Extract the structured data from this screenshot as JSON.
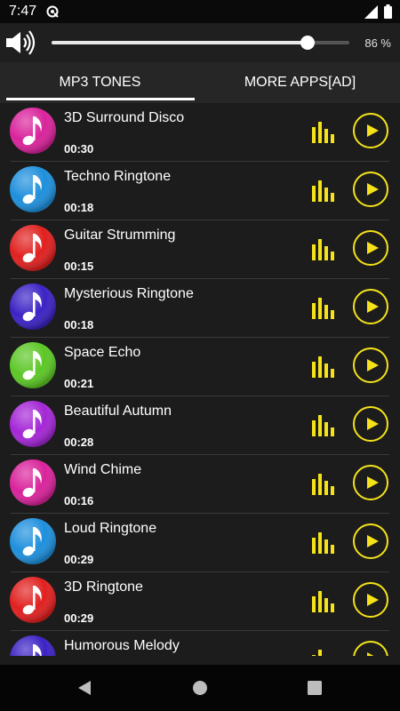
{
  "status_bar": {
    "time": "7:47"
  },
  "volume": {
    "percent_label": "86 %",
    "level": 0.86
  },
  "tabs": [
    {
      "label": "MP3 TONES",
      "selected": true
    },
    {
      "label": "MORE APPS[AD]",
      "selected": false
    }
  ],
  "colors": {
    "accent": "#f5e21b",
    "background": "#1c1c1c",
    "tab_bar": "#262626"
  },
  "ringtones": [
    {
      "title": "3D Surround Disco",
      "duration": "00:30",
      "color": "#d9239b"
    },
    {
      "title": "Techno Ringtone",
      "duration": "00:18",
      "color": "#1e8fdc"
    },
    {
      "title": "Guitar Strumming",
      "duration": "00:15",
      "color": "#e0201f"
    },
    {
      "title": "Mysterious Ringtone",
      "duration": "00:18",
      "color": "#3b22c4"
    },
    {
      "title": "Space Echo",
      "duration": "00:21",
      "color": "#5cc726"
    },
    {
      "title": "Beautiful Autumn",
      "duration": "00:28",
      "color": "#a426d6"
    },
    {
      "title": "Wind Chime",
      "duration": "00:16",
      "color": "#d9239b"
    },
    {
      "title": "Loud Ringtone",
      "duration": "00:29",
      "color": "#1e8fdc"
    },
    {
      "title": "3D Ringtone",
      "duration": "00:29",
      "color": "#e0201f"
    },
    {
      "title": "Humorous Melody",
      "duration": "",
      "color": "#3b22c4"
    }
  ],
  "icons": {
    "row_icon": "music-note-icon",
    "level": "equalizer-icon",
    "action": "play-icon",
    "speaker": "volume-icon"
  }
}
